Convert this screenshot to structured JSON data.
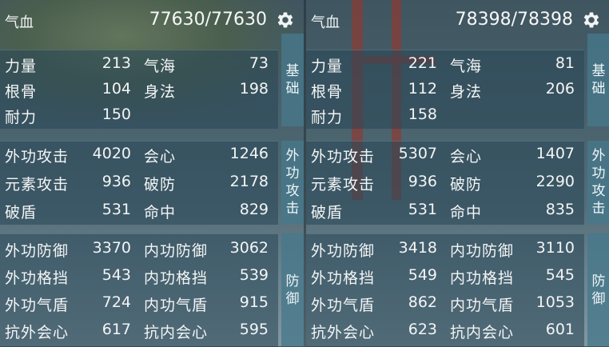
{
  "left": {
    "hp_label": "气血",
    "hp_value": "77630/77630",
    "tags": {
      "basic": [
        "基",
        "础"
      ],
      "attack": [
        "外",
        "功",
        "攻",
        "击"
      ],
      "defense": [
        "防",
        "御"
      ]
    },
    "basic": [
      {
        "name": "力量",
        "value": "213"
      },
      {
        "name": "气海",
        "value": "73"
      },
      {
        "name": "根骨",
        "value": "104"
      },
      {
        "name": "身法",
        "value": "198"
      },
      {
        "name": "耐力",
        "value": "150"
      }
    ],
    "attack": [
      {
        "name": "外功攻击",
        "value": "4020"
      },
      {
        "name": "会心",
        "value": "1246"
      },
      {
        "name": "元素攻击",
        "value": "936"
      },
      {
        "name": "破防",
        "value": "2178"
      },
      {
        "name": "破盾",
        "value": "531"
      },
      {
        "name": "命中",
        "value": "829"
      }
    ],
    "defense": [
      {
        "name": "外功防御",
        "value": "3370"
      },
      {
        "name": "内功防御",
        "value": "3062"
      },
      {
        "name": "外功格挡",
        "value": "543"
      },
      {
        "name": "内功格挡",
        "value": "539"
      },
      {
        "name": "外功气盾",
        "value": "724"
      },
      {
        "name": "内功气盾",
        "value": "915"
      },
      {
        "name": "抗外会心",
        "value": "617"
      },
      {
        "name": "抗内会心",
        "value": "595"
      }
    ]
  },
  "right": {
    "hp_label": "气血",
    "hp_value": "78398/78398",
    "tags": {
      "basic": [
        "基",
        "础"
      ],
      "attack": [
        "外",
        "功",
        "攻",
        "击"
      ],
      "defense": [
        "防",
        "御"
      ]
    },
    "basic": [
      {
        "name": "力量",
        "value": "221"
      },
      {
        "name": "气海",
        "value": "81"
      },
      {
        "name": "根骨",
        "value": "112"
      },
      {
        "name": "身法",
        "value": "206"
      },
      {
        "name": "耐力",
        "value": "158"
      }
    ],
    "attack": [
      {
        "name": "外功攻击",
        "value": "5307"
      },
      {
        "name": "会心",
        "value": "1407"
      },
      {
        "name": "元素攻击",
        "value": "936"
      },
      {
        "name": "破防",
        "value": "2290"
      },
      {
        "name": "破盾",
        "value": "531"
      },
      {
        "name": "命中",
        "value": "835"
      }
    ],
    "defense": [
      {
        "name": "外功防御",
        "value": "3418"
      },
      {
        "name": "内功防御",
        "value": "3110"
      },
      {
        "name": "外功格挡",
        "value": "549"
      },
      {
        "name": "内功格挡",
        "value": "545"
      },
      {
        "name": "外功气盾",
        "value": "862"
      },
      {
        "name": "内功气盾",
        "value": "1053"
      },
      {
        "name": "抗外会心",
        "value": "623"
      },
      {
        "name": "抗内会心",
        "value": "601"
      }
    ]
  },
  "icons": {
    "settings": "gear-icon"
  },
  "colors": {
    "panel_bg": "#28465a",
    "tag_bg": "#46788c",
    "text": "#f3f5f5"
  }
}
